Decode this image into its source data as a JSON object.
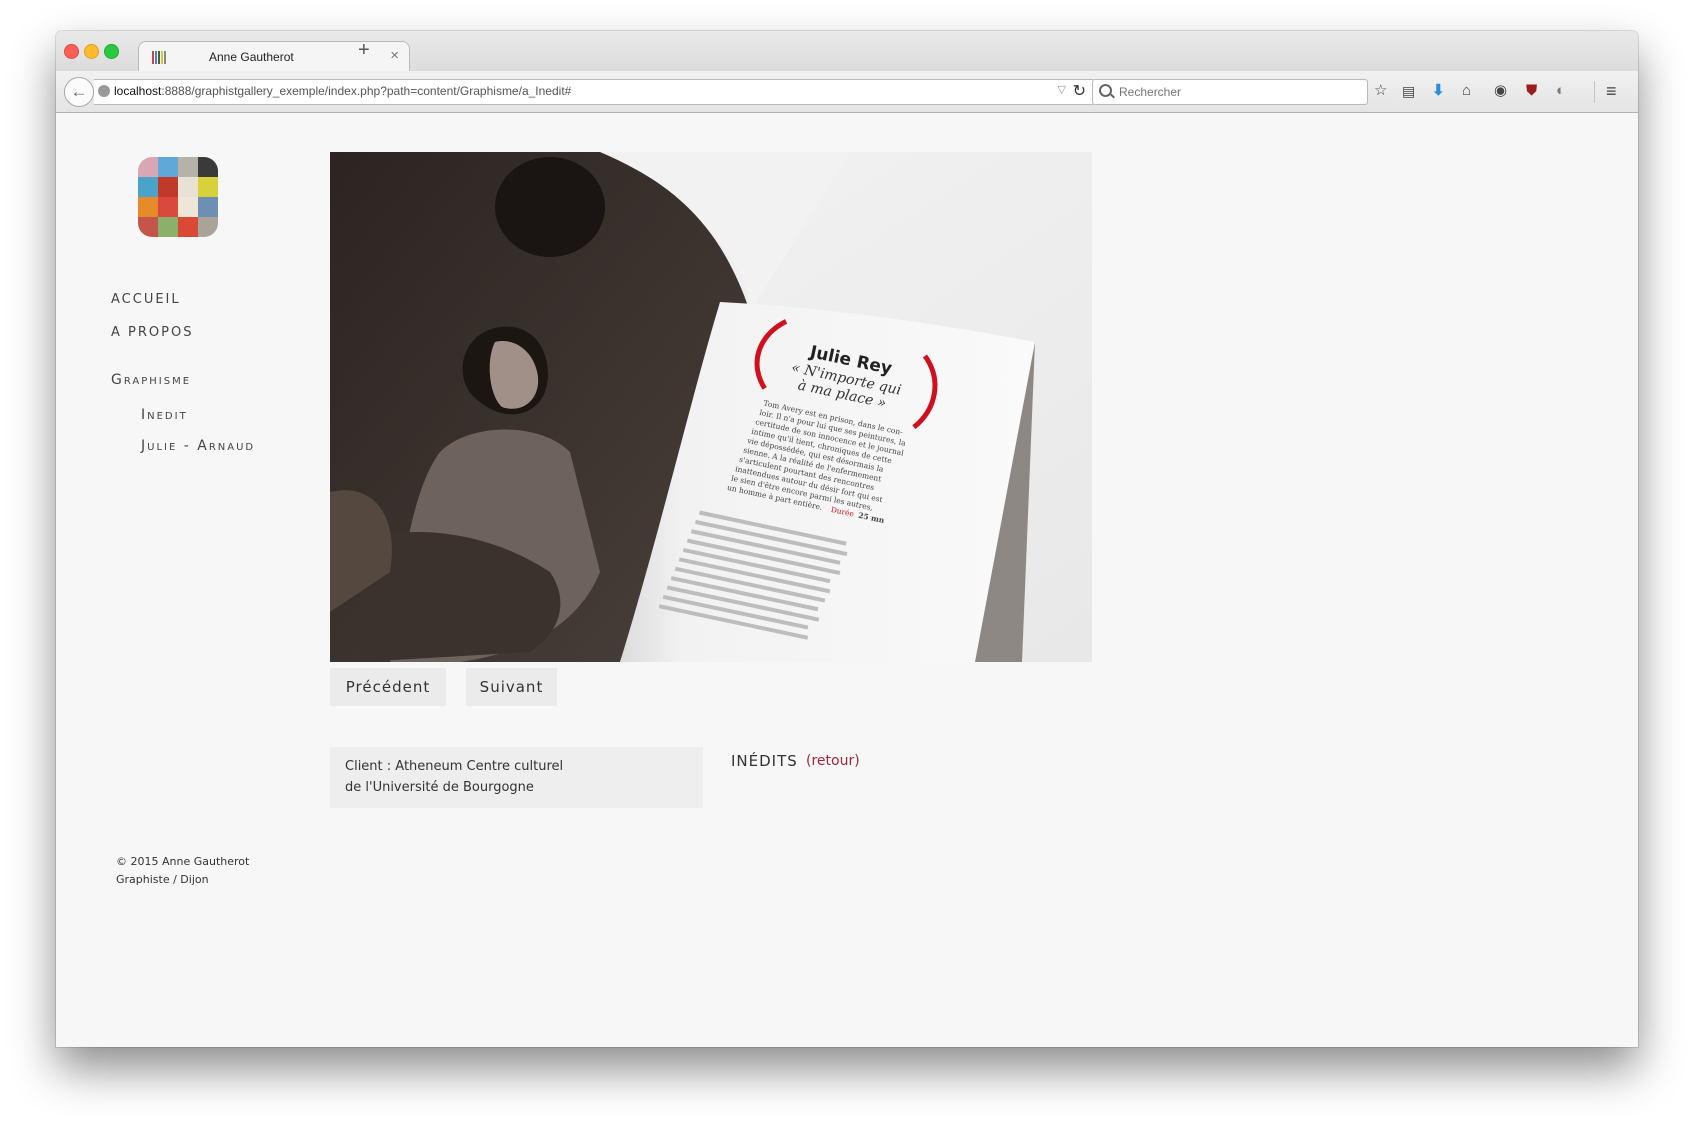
{
  "browser": {
    "tab_title": "Anne Gautherot",
    "url_host": "localhost",
    "url_rest": ":8888/graphistgallery_exemple/index.php?path=content/Graphisme/a_Inedit#",
    "search_placeholder": "Rechercher",
    "icons": [
      "star-icon",
      "reading-list-icon",
      "download-icon",
      "home-icon",
      "chat-icon",
      "ublock-icon",
      "extension-icon",
      "menu-icon"
    ]
  },
  "nav": {
    "accueil": "Accueil",
    "apropos": "A propos",
    "graphisme": "Graphisme",
    "inedit": "Inedit",
    "julie": "Julie - Arnaud"
  },
  "photo": {
    "title": "Julie Rey",
    "subtitle_1": "« N'importe qui",
    "subtitle_2": "à ma place »",
    "body_1": "Tom Avery est en prison, dans le con-",
    "body_2": "loir. Il n'a pour lui que ses peintures, la",
    "body_3": "certitude de son innocence et le journal",
    "body_4": "intime qu'il tient, chroniques de cette",
    "body_5": "vie dépossédée, qui est désormais la",
    "body_6": "sienne. A la réalité de l'enfermement",
    "body_7": "s'articulent pourtant des rencontres",
    "body_8": "inattendues autour du désir fort qui est",
    "body_9": "le sien d'être encore parmi les autres,",
    "body_10": "un homme à part entière.",
    "duree_label": "Durée",
    "duree_value": "25 mn"
  },
  "buttons": {
    "prev": "Précédent",
    "next": "Suivant"
  },
  "info": {
    "client_line1": "Client : Atheneum Centre culturel",
    "client_line2": "de l'Université de Bourgogne"
  },
  "section": {
    "title": "INÉDITS",
    "back": "(retour)"
  },
  "footer": {
    "line1": "© 2015 Anne Gautherot",
    "line2": "Graphiste / Dijon"
  },
  "colors": {
    "accent": "#a0283a",
    "parenthesis_red": "#d0101e"
  }
}
